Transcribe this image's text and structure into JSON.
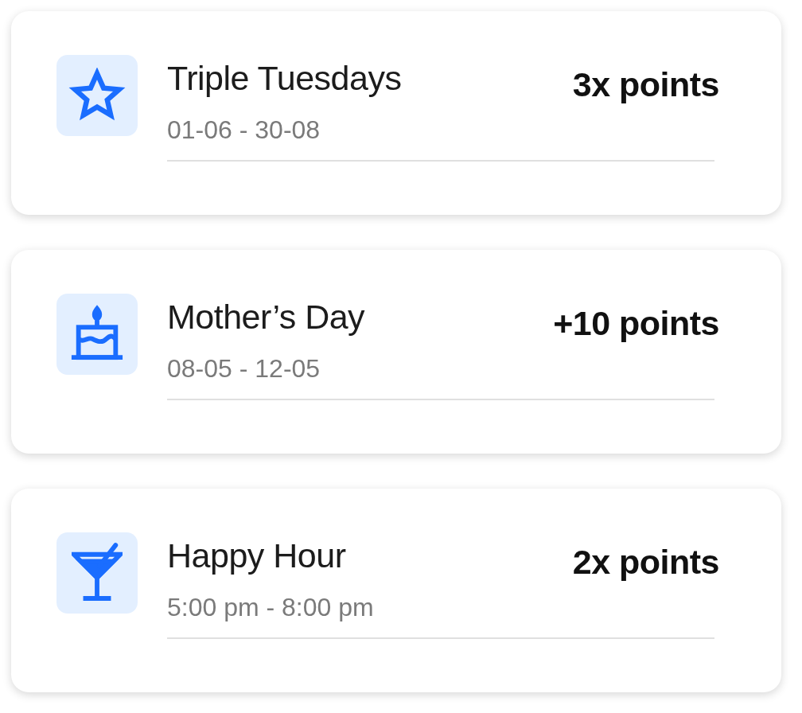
{
  "promotions": [
    {
      "title": "Triple Tuesdays",
      "period": "01-06 - 30-08",
      "reward": "3x points"
    },
    {
      "title": "Mother’s Day",
      "period": "08-05 - 12-05",
      "reward": "+10 points"
    },
    {
      "title": "Happy Hour",
      "period": "5:00 pm - 8:00 pm",
      "reward": "2x points"
    }
  ]
}
